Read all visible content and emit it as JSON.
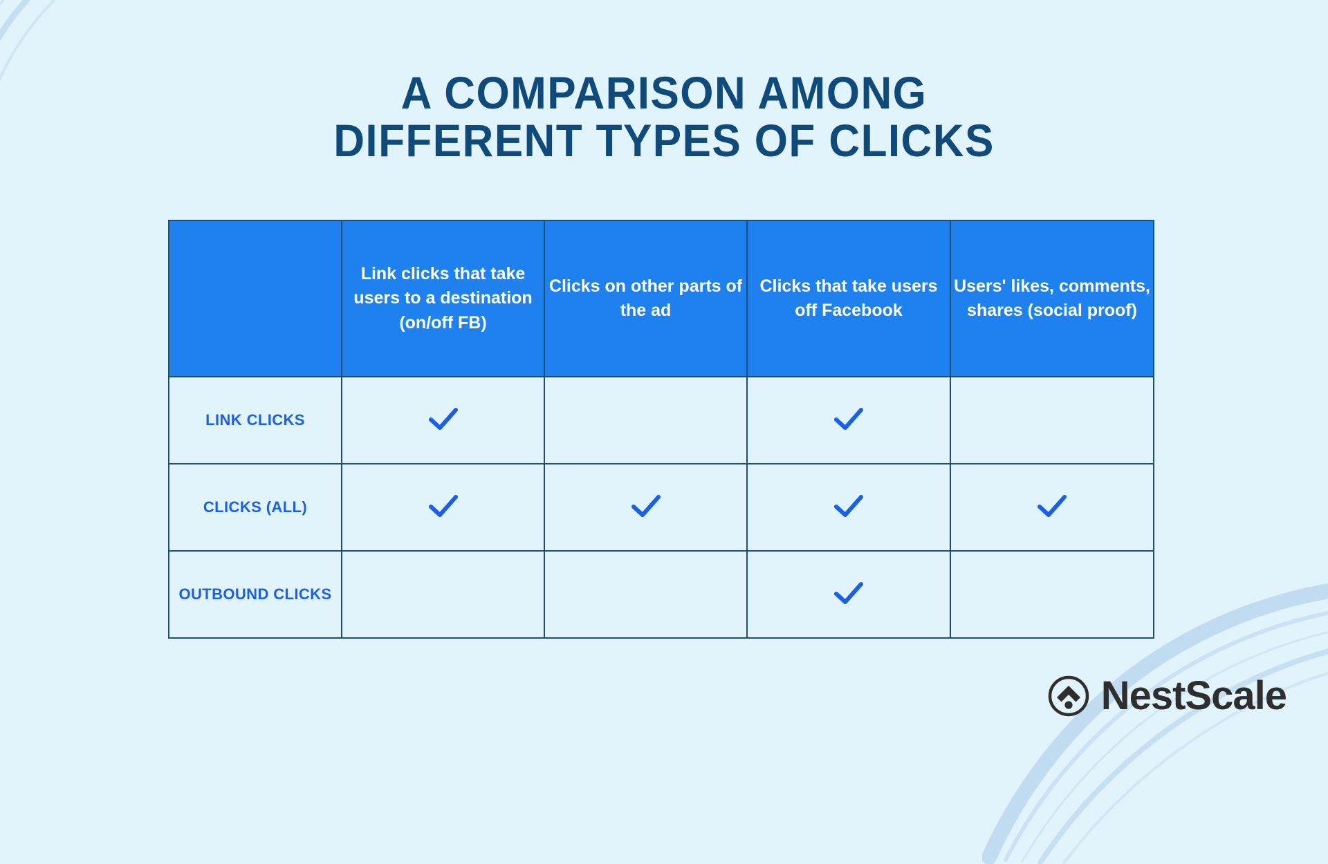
{
  "page": {
    "background_color": "#e2f4fb",
    "title_color": "#104a7a",
    "header_bg_color": "#1f80ef",
    "border_color": "#1d4e73",
    "check_color": "#1a5fe8",
    "row_label_color": "#1a5fe8",
    "logo_color": "#2e2e2e",
    "decoration_color": "#b9d4ee"
  },
  "title": {
    "line1": "A COMPARISON AMONG",
    "line2": "DIFFERENT TYPES OF CLICKS",
    "full": "A COMPARISON AMONG DIFFERENT TYPES OF CLICKS"
  },
  "table": {
    "headers": [
      "",
      "Link clicks that take users to a destination (on/off FB)",
      "Clicks on other parts of the ad",
      "Clicks that take users off Facebook",
      "Users' likes, comments, shares (social proof)"
    ],
    "rows": [
      {
        "label": "LINK CLICKS",
        "cells": [
          "check",
          "",
          "check",
          ""
        ]
      },
      {
        "label": "CLICKS (ALL)",
        "cells": [
          "check",
          "check",
          "check",
          "check"
        ]
      },
      {
        "label": "OUTBOUND CLICKS",
        "cells": [
          "",
          "",
          "check",
          ""
        ]
      }
    ],
    "check_symbol": "check-icon"
  },
  "logo": {
    "mark": "nestscale-mark-icon",
    "text": "NestScale"
  }
}
